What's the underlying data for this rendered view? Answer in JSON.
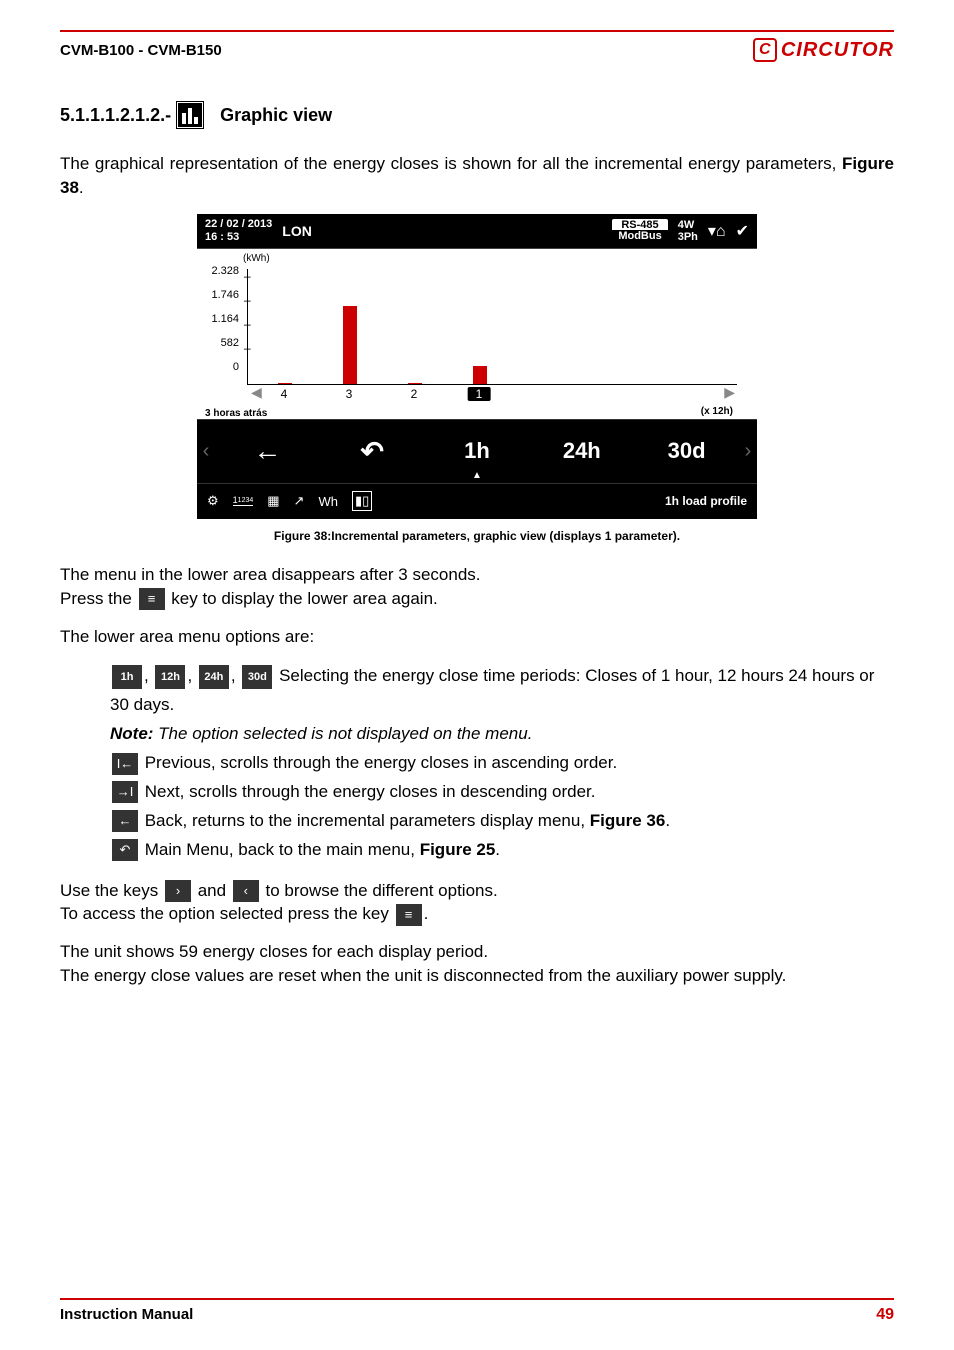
{
  "header": {
    "product": "CVM-B100 - CVM-B150",
    "brand": "CIRCUTOR"
  },
  "section": {
    "number": "5.1.1.1.2.1.2.-",
    "title": "Graphic view"
  },
  "intro": {
    "p1a": "The graphical representation of the energy closes is shown for all the incremental energy parameters, ",
    "p1b": "Figure 38",
    "p1c": "."
  },
  "device": {
    "date": "22 / 02 / 2013",
    "time": "16 : 53",
    "lon": "LON",
    "rs": "RS-485",
    "modbus": "ModBus",
    "w4": "4W",
    "ph3": "3Ph",
    "xunit": "(x  12h)",
    "bottomtext": "3 horas atrás",
    "menu": {
      "h1": "1h",
      "h24": "24h",
      "d30": "30d"
    },
    "bottom": {
      "wh": "Wh",
      "profile": "1h load profile"
    }
  },
  "chart_data": {
    "type": "bar",
    "title": "",
    "ylabel": "(kWh)",
    "xlabel": "",
    "ylim": [
      0,
      2328
    ],
    "yticks": [
      0,
      582,
      1164,
      1746,
      2328
    ],
    "ytick_labels": [
      "0",
      "582",
      "1.164",
      "1.746",
      "2.328"
    ],
    "categories": [
      "4",
      "3",
      "2",
      "1"
    ],
    "values": [
      20,
      1800,
      20,
      400
    ]
  },
  "figcap": "Figure 38:Incremental parameters, graphic view (displays 1 parameter).",
  "after": {
    "p2": "The menu in the lower area disappears after 3 seconds.",
    "p3a": "Press the ",
    "p3b": " key to display the lower area again.",
    "p4": "The lower area menu options are:"
  },
  "opts": {
    "t1h": "1h",
    "t12h": "12h",
    "t24h": "24h",
    "t30d": "30d",
    "sel": " Selecting the energy close time periods: Closes of 1 hour, 12 hours 24 hours or 30 days.",
    "note_lead": "Note:",
    "note": " The option selected is not displayed on the menu.",
    "prev": " Previous, scrolls through the energy closes in ascending order.",
    "next": " Next, scrolls through the energy closes in descending order.",
    "back_a": " Back, returns to the incremental parameters display menu, ",
    "back_b": "Figure 36",
    "back_c": ".",
    "main_a": " Main Menu, back to the main menu, ",
    "main_b": "Figure 25",
    "main_c": "."
  },
  "tail": {
    "p5a": "Use the keys ",
    "p5b": " and ",
    "p5c": " to browse the different options.",
    "p6a": "To access the option selected press the key ",
    "p6b": ".",
    "p7": "The unit shows 59 energy closes for each display period.",
    "p8": "The energy close values are reset when the unit is disconnected from the auxiliary power supply."
  },
  "footer": {
    "left": "Instruction Manual",
    "right": "49"
  }
}
